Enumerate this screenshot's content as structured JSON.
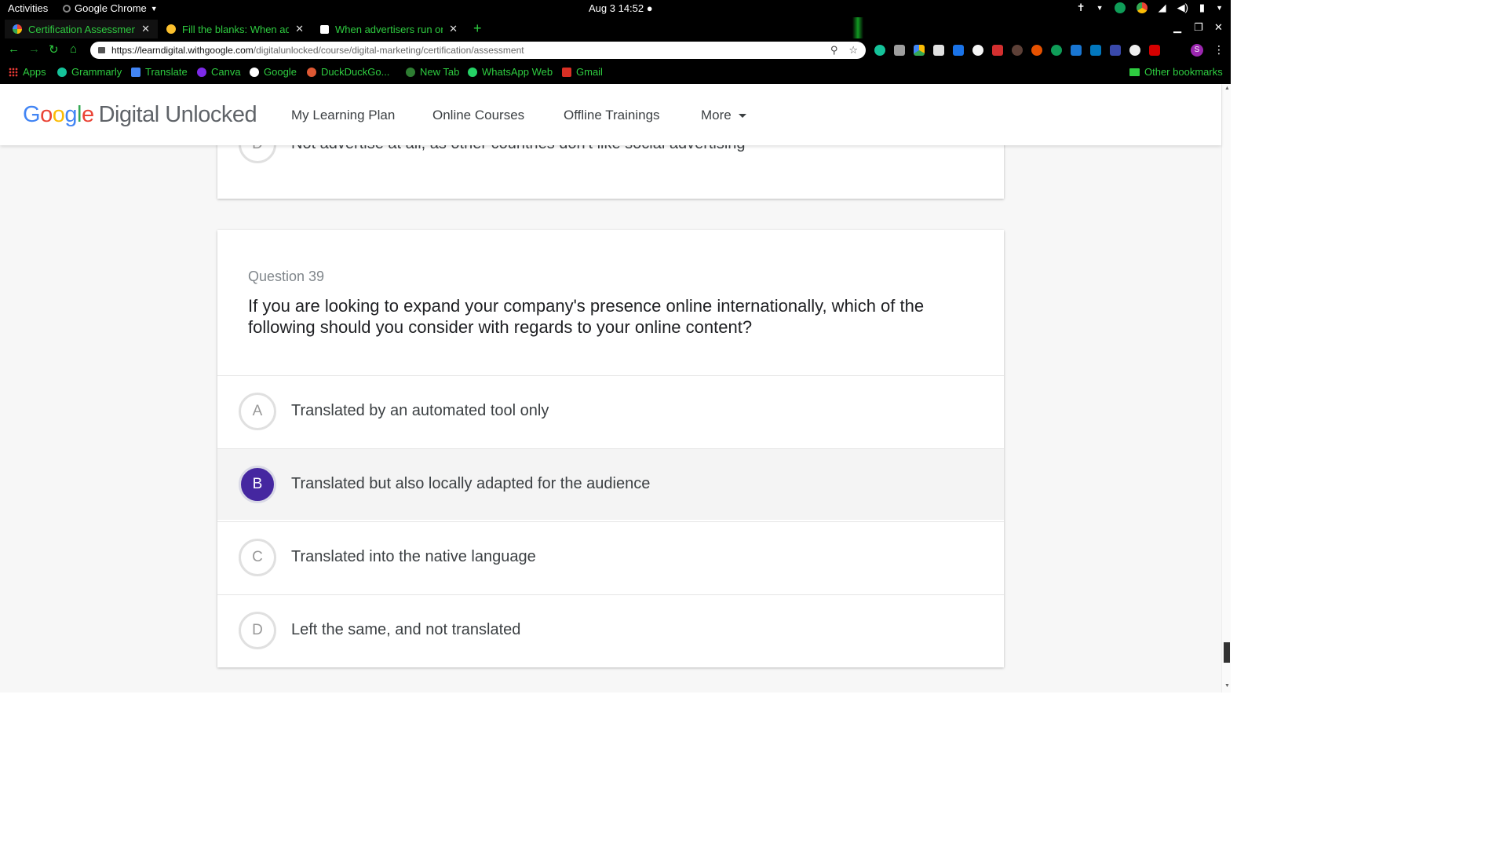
{
  "os_bar": {
    "activities": "Activities",
    "app_name": "Google Chrome",
    "clock": "Aug 3  14:52"
  },
  "tabs": [
    {
      "title": "Certification Assessment",
      "favicon": "google-g-icon"
    },
    {
      "title": "Fill the blanks: When adve",
      "favicon": "yellow-circle-icon"
    },
    {
      "title": "When advertisers run onl",
      "favicon": "b-icon"
    }
  ],
  "address_bar": {
    "host": "https://learndigital.withgoogle.com",
    "path": "/digitalunlocked/course/digital-marketing/certification/assessment"
  },
  "bookmarks": [
    {
      "label": "Apps"
    },
    {
      "label": "Grammarly"
    },
    {
      "label": "Translate"
    },
    {
      "label": "Canva"
    },
    {
      "label": "Google"
    },
    {
      "label": "DuckDuckGo..."
    },
    {
      "label": "New Tab"
    },
    {
      "label": "WhatsApp Web"
    },
    {
      "label": "Gmail"
    },
    {
      "label": "Other bookmarks"
    }
  ],
  "profile_initial": "S",
  "site": {
    "logo_google": [
      "G",
      "o",
      "o",
      "g",
      "l",
      "e"
    ],
    "logo_product": "Digital Unlocked",
    "nav": [
      "My Learning Plan",
      "Online Courses",
      "Offline Trainings",
      "More"
    ]
  },
  "previous_question": {
    "option": {
      "letter": "D",
      "text": "Not advertise at all, as other countries don't like social advertising"
    }
  },
  "question": {
    "label": "Question 39",
    "text": "If you are looking to expand your company's presence online internationally, which of the following should you consider with regards to your online content?",
    "selected": "B",
    "options": [
      {
        "letter": "A",
        "text": "Translated by an automated tool only"
      },
      {
        "letter": "B",
        "text": "Translated but also locally adapted for the audience"
      },
      {
        "letter": "C",
        "text": "Translated into the native language"
      },
      {
        "letter": "D",
        "text": "Left the same, and not translated"
      }
    ]
  },
  "colors": {
    "accent_green": "#2ecc40",
    "selected_option": "#4527a0"
  }
}
